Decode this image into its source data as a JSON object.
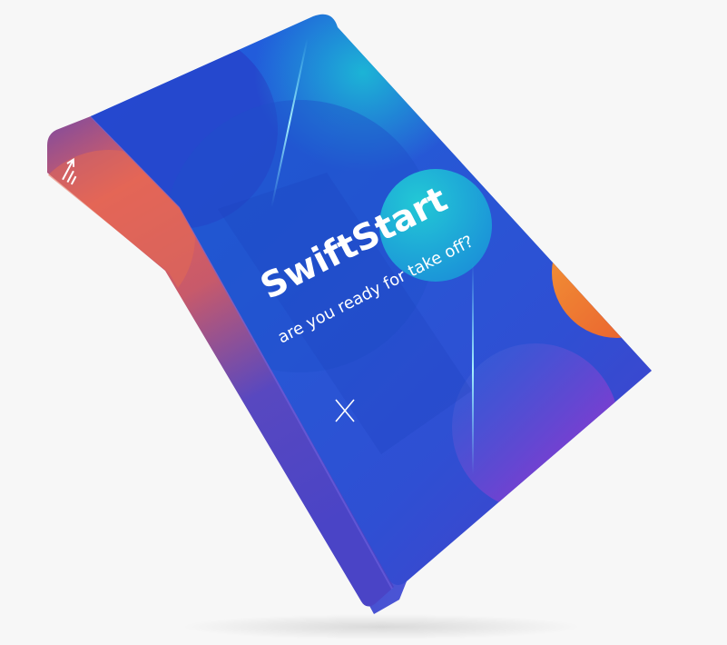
{
  "book": {
    "title": "SwiftStart",
    "subtitle": "are you ready for take off?",
    "spine_logo": "spine-logo",
    "colors": {
      "cover_primary": "#2a54d6",
      "cover_secondary": "#3a2fc4",
      "cyan_accent": "#17c3cf",
      "orange_accent": "#f07a2a",
      "magenta_accent": "#c42fb0",
      "spine_top": "#e0655a",
      "spine_bottom": "#4a42c0",
      "page_edges": "#3b47c7",
      "background": "#f7f7f7"
    },
    "decorations": [
      "light-streak",
      "cross-mark",
      "circle-shape"
    ]
  }
}
